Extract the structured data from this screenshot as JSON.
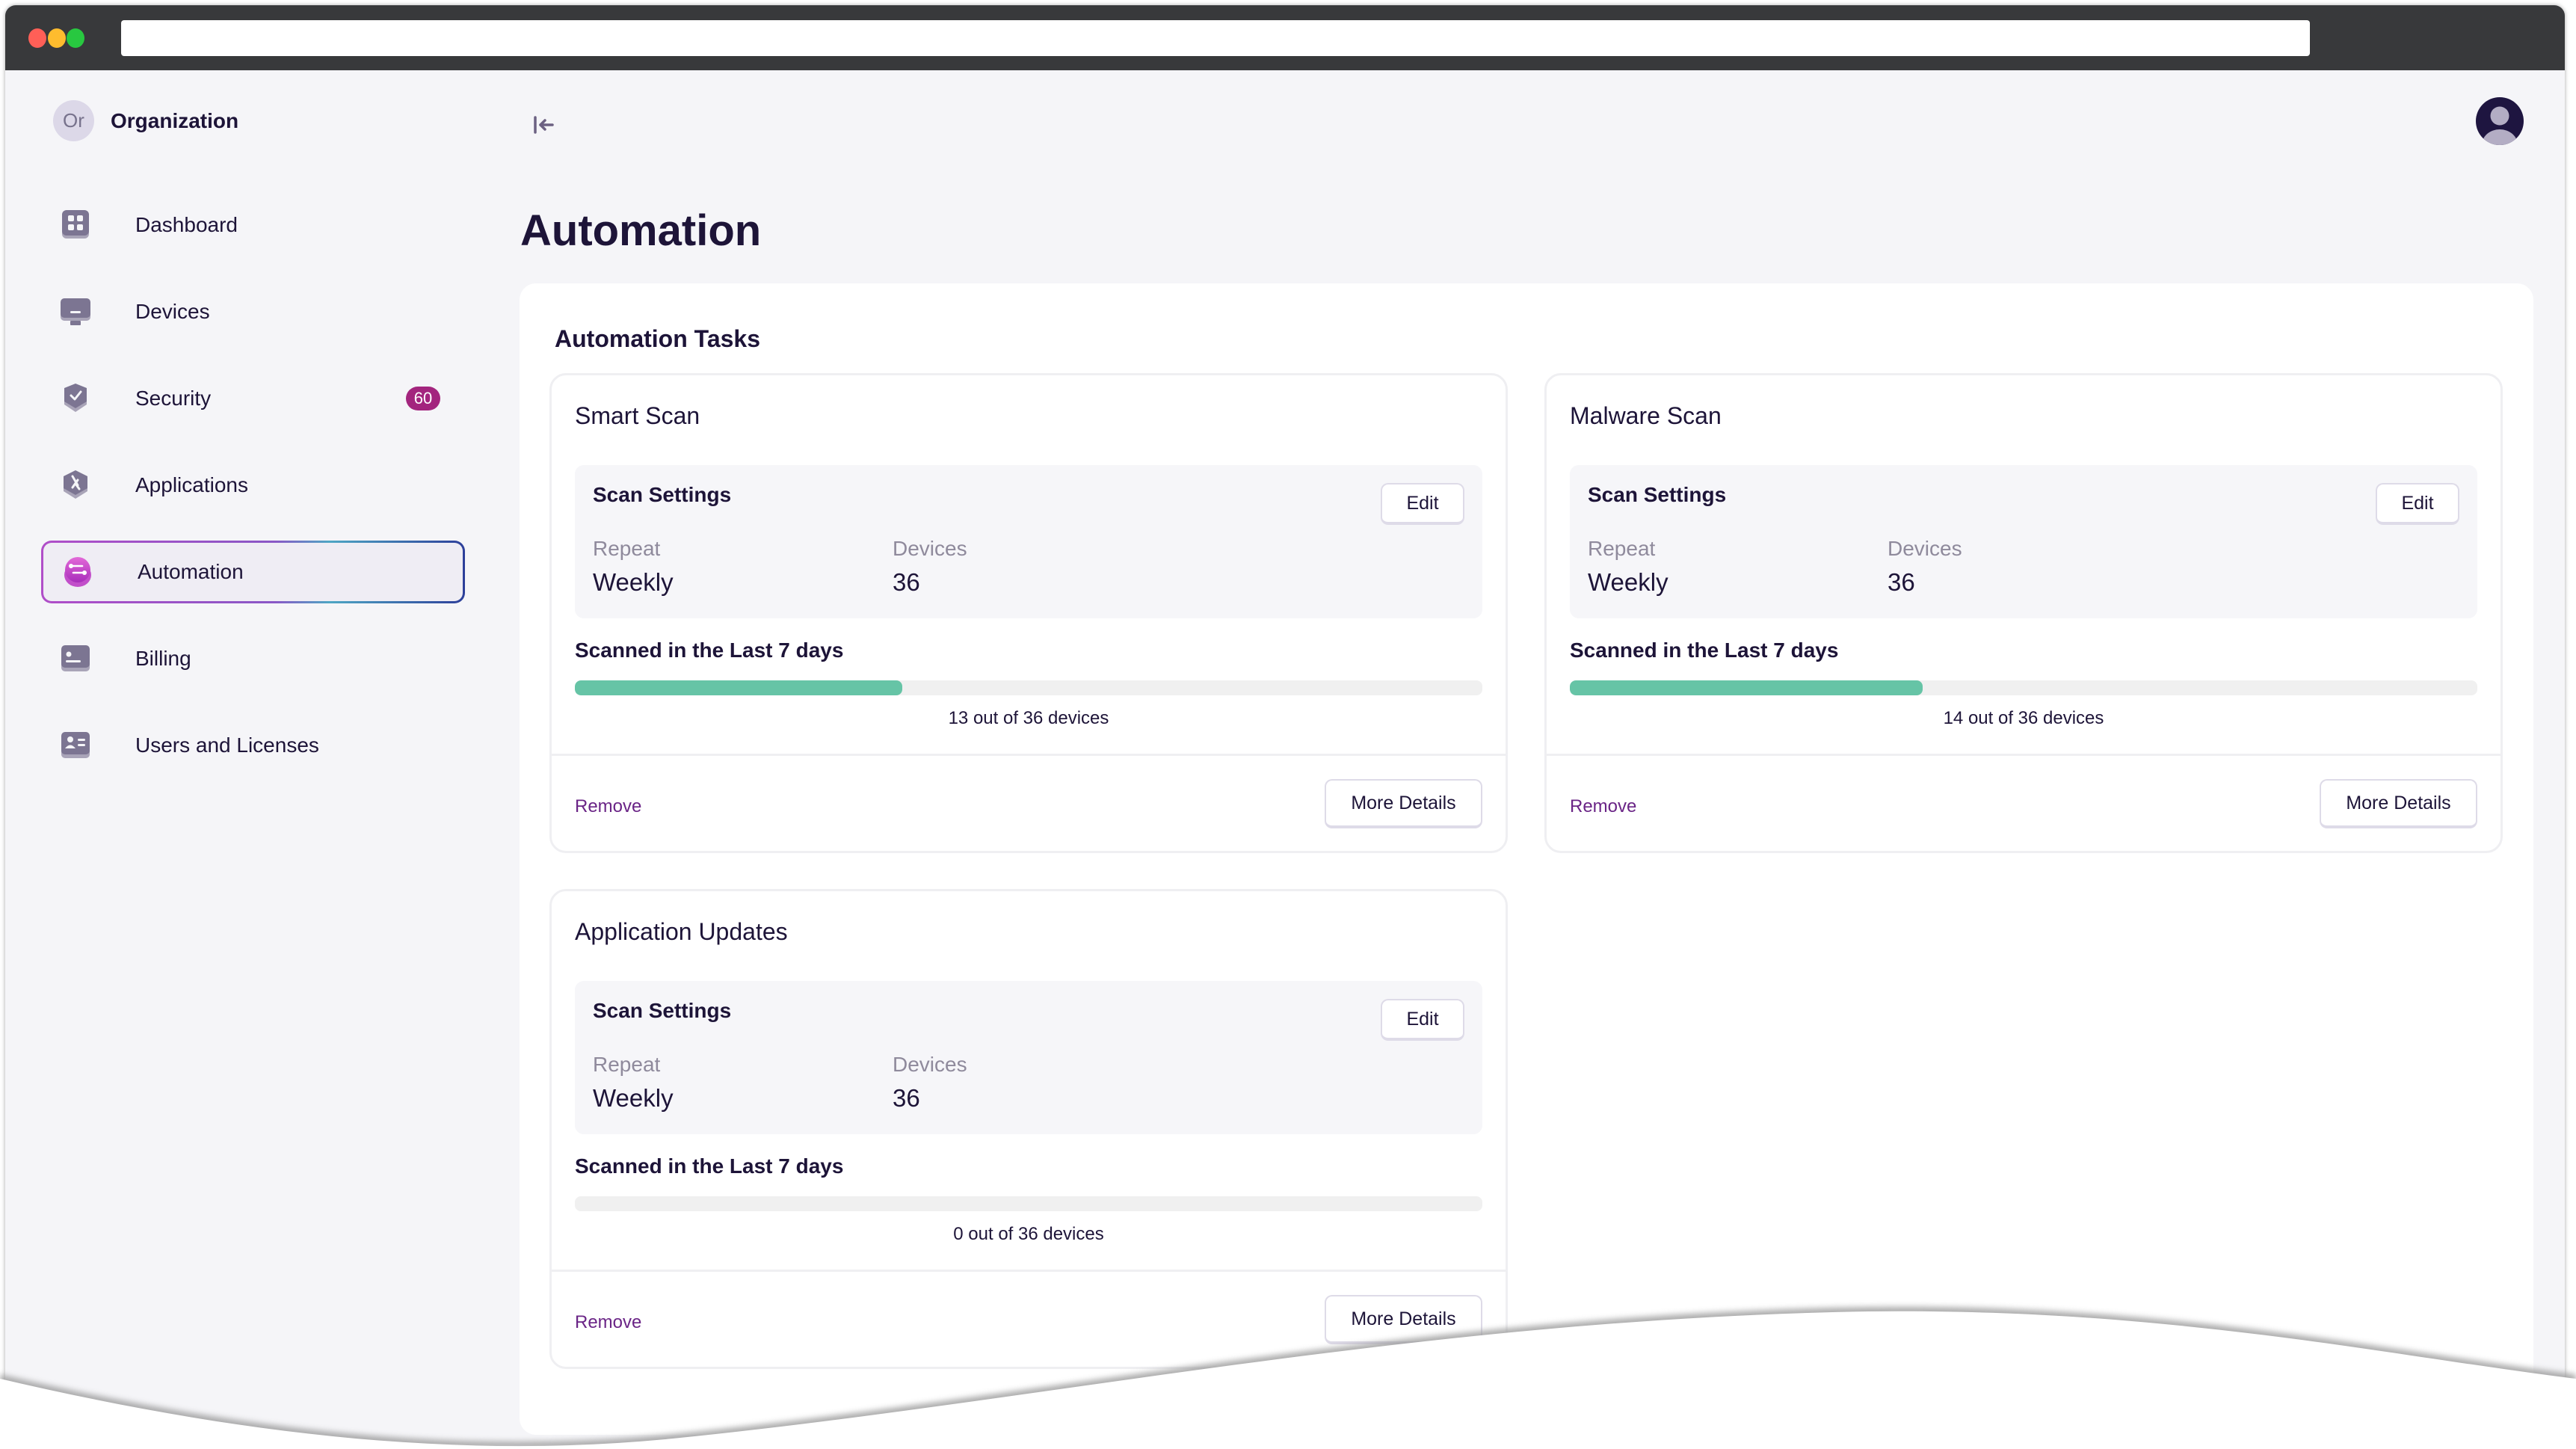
{
  "browser": {
    "url": ""
  },
  "sidebar": {
    "org": {
      "initials": "Or",
      "name": "Organization"
    },
    "collapse_icon": "collapse-sidebar-icon",
    "items": [
      {
        "label": "Dashboard",
        "icon": "dashboard-icon",
        "active": false
      },
      {
        "label": "Devices",
        "icon": "monitor-icon",
        "active": false
      },
      {
        "label": "Security",
        "icon": "shield-check-icon",
        "active": false,
        "badge": "60"
      },
      {
        "label": "Applications",
        "icon": "applications-icon",
        "active": false
      },
      {
        "label": "Automation",
        "icon": "automation-icon",
        "active": true
      },
      {
        "label": "Billing",
        "icon": "billing-card-icon",
        "active": false
      },
      {
        "label": "Users and Licenses",
        "icon": "user-id-card-icon",
        "active": false
      }
    ]
  },
  "header": {
    "user_avatar_icon": "user-avatar-icon"
  },
  "main": {
    "title": "Automation",
    "section_title": "Automation Tasks",
    "tasks": [
      {
        "name": "Smart Scan",
        "settings_title": "Scan Settings",
        "edit_label": "Edit",
        "repeat_label": "Repeat",
        "repeat_value": "Weekly",
        "devices_label": "Devices",
        "devices_value": "36",
        "scanned_title": "Scanned in the Last 7 days",
        "scanned": 13,
        "total": 36,
        "scanned_text": "13 out of 36 devices",
        "remove_label": "Remove",
        "details_label": "More Details"
      },
      {
        "name": "Malware Scan",
        "settings_title": "Scan Settings",
        "edit_label": "Edit",
        "repeat_label": "Repeat",
        "repeat_value": "Weekly",
        "devices_label": "Devices",
        "devices_value": "36",
        "scanned_title": "Scanned in the Last 7 days",
        "scanned": 14,
        "total": 36,
        "scanned_text": "14 out of 36 devices",
        "remove_label": "Remove",
        "details_label": "More Details"
      },
      {
        "name": "Application Updates",
        "settings_title": "Scan Settings",
        "edit_label": "Edit",
        "repeat_label": "Repeat",
        "repeat_value": "Weekly",
        "devices_label": "Devices",
        "devices_value": "36",
        "scanned_title": "Scanned in the Last 7 days",
        "scanned": 0,
        "total": 36,
        "scanned_text": "0 out of 36 devices",
        "remove_label": "Remove",
        "details_label": "More Details"
      }
    ]
  },
  "colors": {
    "accent": "#a3257e",
    "progress": "#66c4a6",
    "remove_link": "#6a2486",
    "text_primary": "#1d1438",
    "text_muted": "#8f8a9c"
  }
}
